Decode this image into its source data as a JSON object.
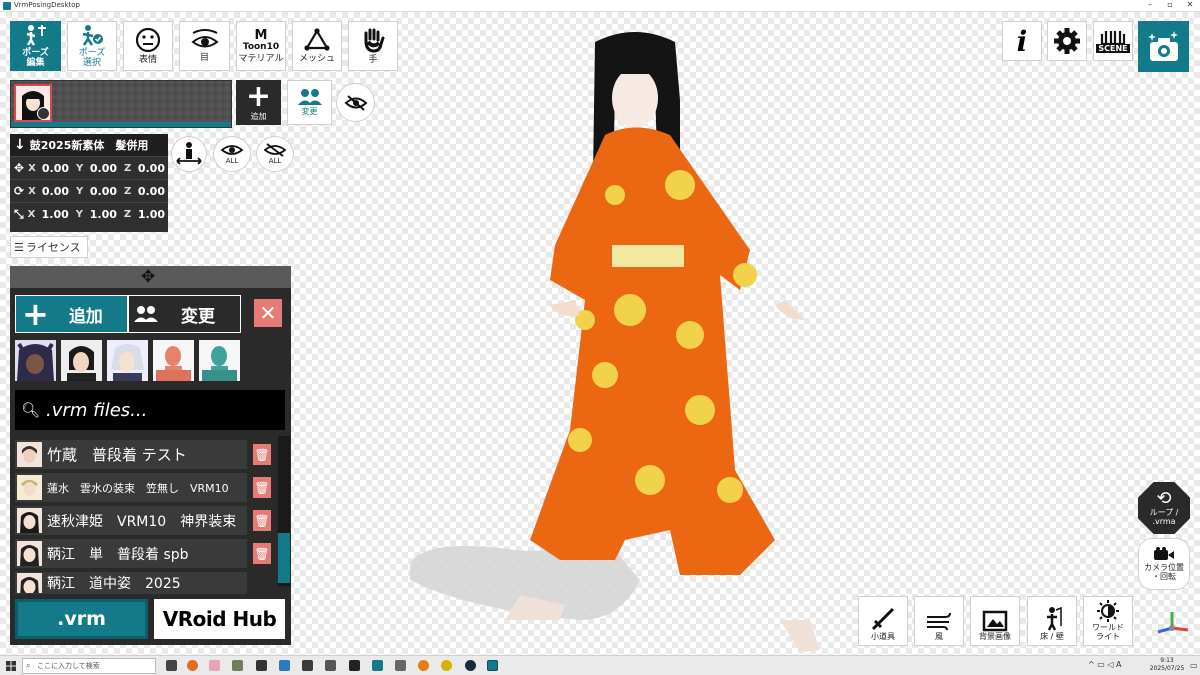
{
  "window": {
    "title": "VrmPosingDesktop",
    "controls": [
      "–",
      "▫",
      "✕"
    ]
  },
  "toolbar": [
    {
      "name": "pose-edit",
      "label_l1": "ポーズ",
      "label_l2": "編集",
      "active": true
    },
    {
      "name": "pose-select",
      "label_l1": "ポーズ",
      "label_l2": "選択"
    },
    {
      "name": "expression",
      "label": "表情"
    },
    {
      "name": "eye",
      "label": "目"
    },
    {
      "name": "material",
      "icon_text_l1": "M",
      "icon_text_l2": "Toon10",
      "label": "マテリアル"
    },
    {
      "name": "mesh",
      "label": "メッシュ"
    },
    {
      "name": "hand",
      "label": "手"
    }
  ],
  "model_slot": {
    "add_label": "追加",
    "change_label": "変更"
  },
  "transform": {
    "model_name": "鼓2025新素体　髮併用",
    "rows": [
      {
        "kind": "position",
        "x": "0.00",
        "y": "0.00",
        "z": "0.00"
      },
      {
        "kind": "rotation",
        "x": "0.00",
        "y": "0.00",
        "z": "0.00"
      },
      {
        "kind": "scale",
        "x": "1.00",
        "y": "1.00",
        "z": "1.00"
      }
    ],
    "axis_x": "X",
    "axis_y": "Y",
    "axis_z": "Z",
    "show_all": "ALL",
    "hide_all": "ALL"
  },
  "license_label": "ライセンス",
  "list_panel": {
    "add_label": "追加",
    "change_label": "変更",
    "close_label": "✕",
    "search_placeholder": ".vrm files...",
    "models": [
      {
        "name": "竹蔵　普段着 テスト",
        "size": 15
      },
      {
        "name": "蓮水　雲水の装束　笠無し　VRM10",
        "size": 11
      },
      {
        "name": "速秋津姫　VRM10　神界装束",
        "size": 14
      },
      {
        "name": "鞆江　単　普段着 spb",
        "size": 14
      },
      {
        "name": "鞆江　道中姿　2025",
        "size": 14
      }
    ],
    "vrm_button": ".vrm",
    "vroid_button": "VRoid Hub"
  },
  "right_toolbar": {
    "info": "i",
    "scene": "SCENE"
  },
  "loop_label_l1": "ループ /",
  "loop_label_l2": ".vrma",
  "camera_label_l1": "カメラ位置",
  "camera_label_l2": "・回転",
  "bottom_buttons": [
    {
      "name": "props",
      "label": "小道具"
    },
    {
      "name": "wind",
      "label": "風"
    },
    {
      "name": "background-image",
      "label": "背景画像"
    },
    {
      "name": "floor-wall",
      "label": "床 / 壁"
    },
    {
      "name": "world-light",
      "label_l1": "ワールド",
      "label_l2": "ライト"
    }
  ],
  "taskbar": {
    "search_placeholder": "ここに入力して検索",
    "time": "9:13",
    "date": "2025/07/25"
  },
  "colors": {
    "accent": "#137a8a",
    "danger": "#e57a76",
    "panel": "#2a2a2a"
  }
}
